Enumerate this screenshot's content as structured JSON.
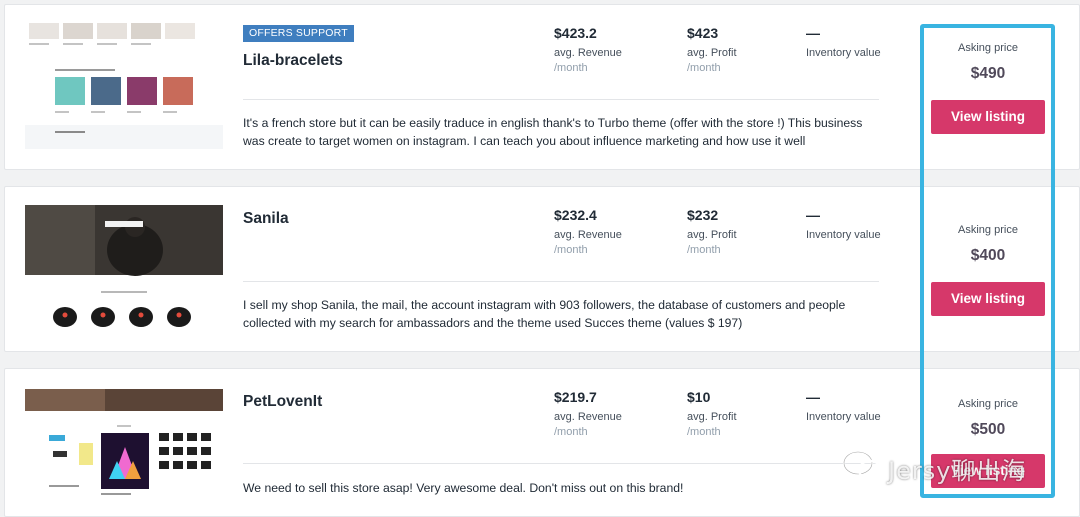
{
  "listings": [
    {
      "badge": "OFFERS SUPPORT",
      "name": "Lila-bracelets",
      "revenue": {
        "value": "$423.2",
        "label": "avg. Revenue",
        "period": "/month"
      },
      "profit": {
        "value": "$423",
        "label": "avg. Profit",
        "period": "/month"
      },
      "inventory": {
        "value": "—",
        "label": "Inventory value"
      },
      "description": "It's a french store but it can be easily traduce in english thank's to Turbo theme (offer with the store !) This business was create to target women on instagram. I can teach you about influence marketing and how use it well",
      "asking_label": "Asking price",
      "asking_price": "$490",
      "button": "View listing"
    },
    {
      "name": "Sanila",
      "revenue": {
        "value": "$232.4",
        "label": "avg. Revenue",
        "period": "/month"
      },
      "profit": {
        "value": "$232",
        "label": "avg. Profit",
        "period": "/month"
      },
      "inventory": {
        "value": "—",
        "label": "Inventory value"
      },
      "description": "I sell my shop Sanila, the mail, the account instagram with 903 followers, the database of customers and people collected with my search for ambassadors and the theme used Succes theme (values $ 197)",
      "asking_label": "Asking price",
      "asking_price": "$400",
      "button": "View listing"
    },
    {
      "name": "PetLovenIt",
      "revenue": {
        "value": "$219.7",
        "label": "avg. Revenue",
        "period": "/month"
      },
      "profit": {
        "value": "$10",
        "label": "avg. Profit",
        "period": "/month"
      },
      "inventory": {
        "value": "—",
        "label": "Inventory value"
      },
      "description": "We need to sell this store asap! Very awesome deal. Don't miss out on this brand!",
      "asking_label": "Asking price",
      "asking_price": "$500",
      "button": "View listing"
    }
  ],
  "watermark": {
    "text": "Jersy聊出海",
    "icon": "wechat-icon"
  },
  "colors": {
    "accent": "#d6386a",
    "badge": "#3f7ebf",
    "highlight": "#39b4e1",
    "price": "#50495a"
  }
}
